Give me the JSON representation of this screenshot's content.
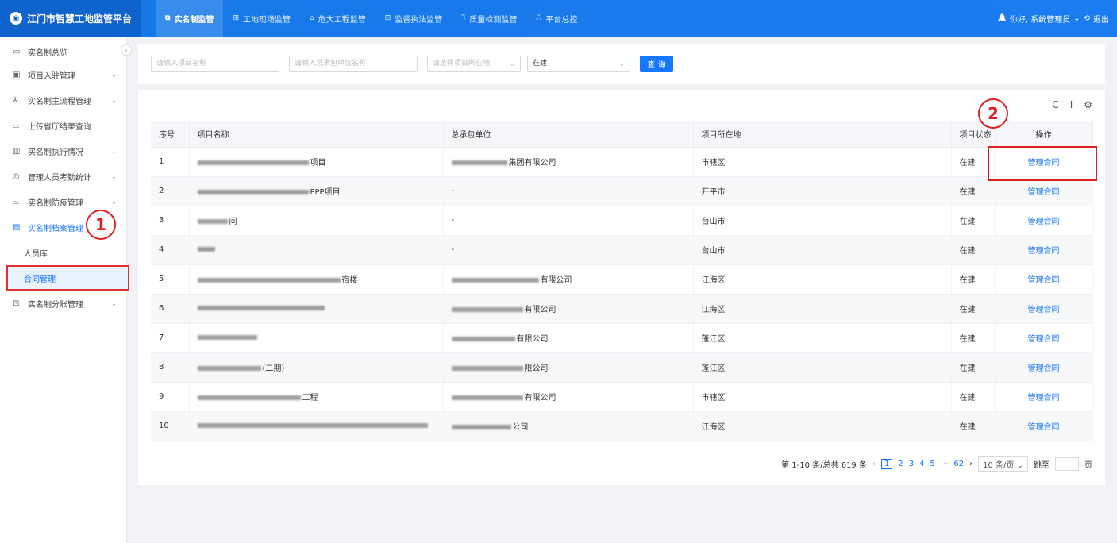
{
  "app": {
    "logo_char": "◉",
    "title": "江门市智慧工地监管平台"
  },
  "topnav": [
    {
      "icon": "⧉",
      "label": "实名制监管",
      "active": true
    },
    {
      "icon": "⊞",
      "label": "工地现场监管"
    },
    {
      "icon": "⌂",
      "label": "危大工程监管"
    },
    {
      "icon": "⊡",
      "label": "监督执法监管"
    },
    {
      "icon": "⅂",
      "label": "质量检测监管"
    },
    {
      "icon": "ஃ",
      "label": "平台总控"
    }
  ],
  "user": {
    "bell_icon": "🔔",
    "greeting": "你好, 系统管理员",
    "caret": "⌄",
    "logout_icon": "⟲",
    "logout": "退出"
  },
  "sidebar": {
    "items": [
      {
        "icon": "▭",
        "label": "实名制总览",
        "arrow": ""
      },
      {
        "icon": "▣",
        "label": "项目入驻管理",
        "arrow": "⌄"
      },
      {
        "icon": "⅄",
        "label": "实名制主流程管理",
        "arrow": "⌄"
      },
      {
        "icon": "⌓",
        "label": "上传省厅结果查询",
        "arrow": ""
      },
      {
        "icon": "▥",
        "label": "实名制执行情况",
        "arrow": "⌄"
      },
      {
        "icon": "◎",
        "label": "管理人员考勤统计",
        "arrow": "⌄"
      },
      {
        "icon": "⌓",
        "label": "实名制防疫管理",
        "arrow": "⌄"
      },
      {
        "icon": "▤",
        "label": "实名制档案管理",
        "arrow": "⌃"
      },
      {
        "icon": "",
        "label": "人员库",
        "arrow": ""
      },
      {
        "icon": "",
        "label": "合同管理",
        "arrow": ""
      },
      {
        "icon": "⊡",
        "label": "实名制分账管理",
        "arrow": "⌄"
      }
    ],
    "collapse": "‹"
  },
  "annotations": {
    "a1": "1",
    "a2": "2"
  },
  "filters": {
    "project_placeholder": "请输入项目名称",
    "contractor_placeholder": "请输入总承包单位名称",
    "location_placeholder": "请选择项目所在地",
    "status_value": "在建",
    "dropdown": "⌄",
    "query": "查 询"
  },
  "tools": {
    "refresh": "C",
    "density": "I",
    "settings": "⚙"
  },
  "table": {
    "headers": [
      "序号",
      "项目名称",
      "总承包单位",
      "项目所在地",
      "项目状态",
      "操作"
    ],
    "rows": [
      {
        "no": "1",
        "name": "项目",
        "contractor": "集团有限公司",
        "location": "市辖区",
        "status": "在建",
        "op": "管理合同"
      },
      {
        "no": "2",
        "name": "PPP项目",
        "contractor": "-",
        "location": "开平市",
        "status": "在建",
        "op": "管理合同"
      },
      {
        "no": "3",
        "name": "间",
        "contractor": "-",
        "location": "台山市",
        "status": "在建",
        "op": "管理合同"
      },
      {
        "no": "4",
        "name": "",
        "contractor": "-",
        "location": "台山市",
        "status": "在建",
        "op": "管理合同"
      },
      {
        "no": "5",
        "name": "宿楼",
        "contractor": "有限公司",
        "location": "江海区",
        "status": "在建",
        "op": "管理合同"
      },
      {
        "no": "6",
        "name": "",
        "contractor": "有限公司",
        "location": "江海区",
        "status": "在建",
        "op": "管理合同"
      },
      {
        "no": "7",
        "name": "",
        "contractor": "有限公司",
        "location": "蓬江区",
        "status": "在建",
        "op": "管理合同"
      },
      {
        "no": "8",
        "name": "(二期)",
        "contractor": "限公司",
        "location": "蓬江区",
        "status": "在建",
        "op": "管理合同"
      },
      {
        "no": "9",
        "name": "工程",
        "contractor": "有限公司",
        "location": "市辖区",
        "status": "在建",
        "op": "管理合同"
      },
      {
        "no": "10",
        "name": "",
        "contractor": "公司",
        "location": "江海区",
        "status": "在建",
        "op": "管理合同"
      }
    ]
  },
  "pager": {
    "summary": "第 1-10 条/总共 619 条",
    "prev": "‹",
    "pages": [
      "1",
      "2",
      "3",
      "4",
      "5"
    ],
    "ellipsis": "···",
    "last": "62",
    "next": "›",
    "size": "10 条/页",
    "size_caret": "⌄",
    "jump_label": "跳至",
    "page_unit": "页"
  }
}
